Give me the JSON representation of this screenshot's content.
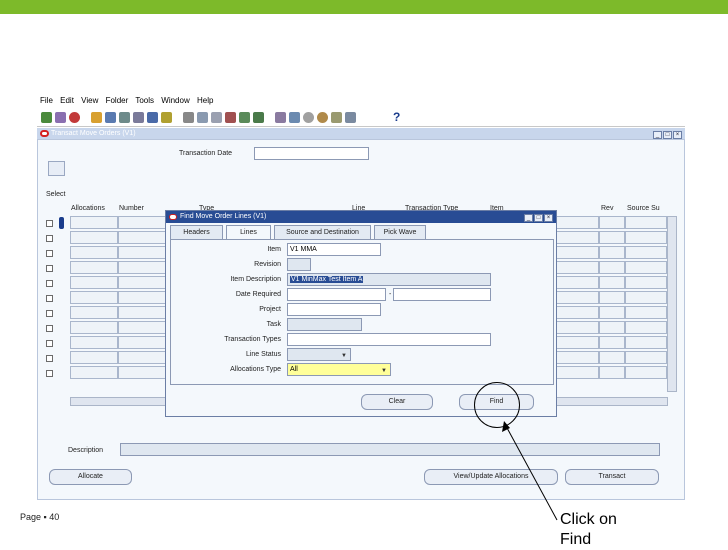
{
  "menu": [
    "File",
    "Edit",
    "View",
    "Folder",
    "Tools",
    "Window",
    "Help"
  ],
  "help_glyph": "?",
  "window": {
    "title": "Transact Move Orders (V1)",
    "buttons": [
      "_",
      "□",
      "×"
    ]
  },
  "form": {
    "transaction_date_label": "Transaction Date",
    "select_label": "Select",
    "columns": [
      "Allocations",
      "Number",
      "Type",
      "Line",
      "Transaction Type",
      "Item",
      "Rev",
      "Source Su"
    ],
    "description_label": "Description",
    "buttons": {
      "allocate": "Allocate",
      "view_update": "View/Update Allocations",
      "transact": "Transact"
    }
  },
  "dialog": {
    "title": "Find Move Order Lines (V1)",
    "tabs": [
      "Headers",
      "Lines",
      "Source and Destination",
      "Pick Wave"
    ],
    "active_tab": "Lines",
    "fields": {
      "item_label": "Item",
      "item_value": "V1 MMA",
      "revision_label": "Revision",
      "item_desc_label": "Item Description",
      "item_desc_value": "V1 MinMax Test Item A",
      "date_required_label": "Date Required",
      "date_separator": "-",
      "project_label": "Project",
      "task_label": "Task",
      "transaction_types_label": "Transaction Types",
      "line_status_label": "Line Status",
      "allocations_type_label": "Allocations Type",
      "allocations_type_value": "All"
    },
    "buttons": {
      "clear": "Clear",
      "find": "Find"
    }
  },
  "callout": {
    "line1": "Click on",
    "line2": "Find"
  },
  "footer": "Page ▪ 40",
  "colors": {
    "brand_bar": "#7dba2a",
    "dialog_title": "#284c94",
    "highlight": "#ffff99"
  }
}
